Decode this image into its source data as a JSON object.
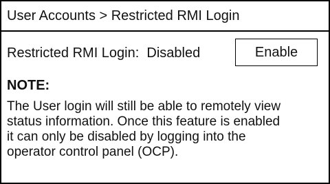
{
  "header": {
    "breadcrumb": "User Accounts > Restricted RMI Login"
  },
  "status": {
    "label": "Restricted RMI Login:",
    "value": "Disabled",
    "button_label": "Enable"
  },
  "note": {
    "title": "NOTE:",
    "lines": [
      "The User login will still be able to remotely view",
      "status information. Once this feature is enabled",
      "it can only be disabled by logging into the",
      "operator control panel (OCP)."
    ]
  }
}
